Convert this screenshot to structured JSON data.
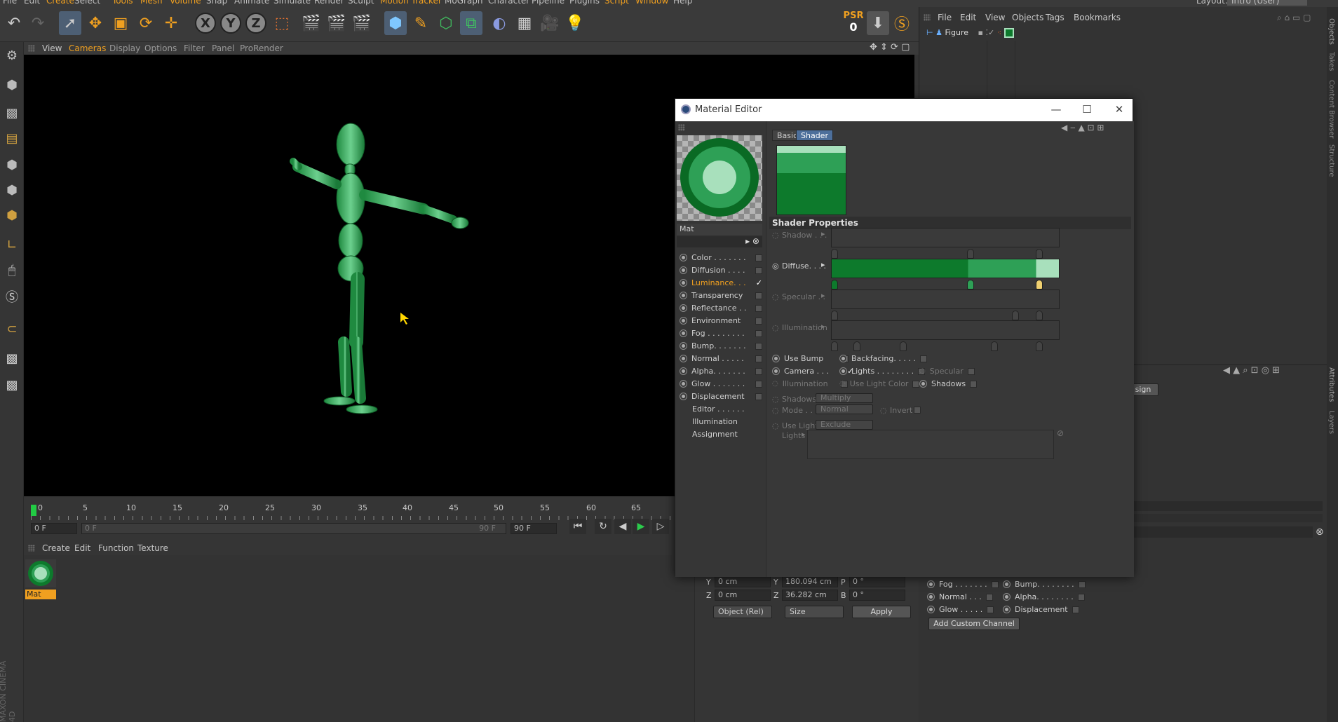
{
  "topmenu": [
    "File",
    "Edit",
    "Create",
    "Select",
    "Tools",
    "Mesh",
    "Volume",
    "Snap",
    "Animate",
    "Simulate",
    "Render",
    "Sculpt",
    "Motion Tracker",
    "MoGraph",
    "Character",
    "Pipeline",
    "Plugins",
    "Script",
    "Window",
    "Help"
  ],
  "layout_label": "Layout:",
  "layout_value": "Intro (User)",
  "toolbar": {
    "axis_x": "X",
    "axis_y": "Y",
    "axis_z": "Z",
    "psr_label": "PSR",
    "psr_value": "0"
  },
  "viewport_menu": [
    "View",
    "Cameras",
    "Display",
    "Options",
    "Filter",
    "Panel",
    "ProRender"
  ],
  "timeline": {
    "ticks": [
      "0",
      "5",
      "10",
      "15",
      "20",
      "25",
      "30",
      "35",
      "40",
      "45",
      "50",
      "55",
      "60",
      "65"
    ],
    "start_field": "0 F",
    "range_start": "0 F",
    "range_end": "90 F",
    "end_field": "90 F"
  },
  "material_menu": [
    "Create",
    "Edit",
    "Function",
    "Texture"
  ],
  "material": {
    "name": "Mat"
  },
  "coord": {
    "y_pos": "0 cm",
    "y_size": "180.094 cm",
    "p_rot": "0 °",
    "z_pos": "0 cm",
    "z_size": "36.282 cm",
    "b_rot": "0 °",
    "label_y": "Y",
    "label_z": "Z",
    "label_p": "P",
    "label_b": "B",
    "mode": "Object (Rel)",
    "size_mode": "Size",
    "apply": "Apply"
  },
  "objmgr": {
    "menu": [
      "File",
      "Edit",
      "View",
      "Objects",
      "Tags",
      "Bookmarks"
    ],
    "object_name": "Figure"
  },
  "attr": {
    "assign_button": "sign",
    "channels_left": [
      "Fog . . . . . . .",
      "Normal . . .",
      "Glow . . . . ."
    ],
    "channels_right": [
      "Bump. . . . . . . .",
      "Alpha. . . . . . . .",
      "Displacement"
    ],
    "add_custom_channel": "Add Custom Channel"
  },
  "right_strip": [
    "Objects",
    "Takes",
    "Content Browser",
    "Structure",
    "Attributes",
    "Layers"
  ],
  "material_editor": {
    "title": "Material Editor",
    "mat_name": "Mat",
    "channels": [
      {
        "label": "Color . . . . . . .",
        "checked": false
      },
      {
        "label": "Diffusion . . . .",
        "checked": false
      },
      {
        "label": "Luminance. . .",
        "checked": true
      },
      {
        "label": "Transparency",
        "checked": false
      },
      {
        "label": "Reflectance . .",
        "checked": false
      },
      {
        "label": "Environment",
        "checked": false
      },
      {
        "label": "Fog . . . . . . . .",
        "checked": false
      },
      {
        "label": "Bump. . . . . . .",
        "checked": false
      },
      {
        "label": "Normal . . . . .",
        "checked": false
      },
      {
        "label": "Alpha. . . . . . .",
        "checked": false
      },
      {
        "label": "Glow . . . . . . .",
        "checked": false
      },
      {
        "label": "Displacement",
        "checked": false
      }
    ],
    "extra": [
      "Editor . . . . . .",
      "Illumination",
      "Assignment"
    ],
    "tabs": [
      "Basic",
      "Shader"
    ],
    "section": "Shader Properties",
    "props": {
      "shadow": "Shadow . . .",
      "diffuse": "Diffuse. . . .",
      "specular": "Specular . .",
      "illumination": "Illumination",
      "use_bump": "Use Bump",
      "backfacing": "Backfacing. . . . .",
      "camera": "Camera . . .",
      "lights": "Lights . . . . . . . .",
      "specular2": "Specular",
      "illumination2": "Illumination",
      "use_light_color": "Use Light Color",
      "shadows": "Shadows",
      "shadows_label": "Shadows",
      "shadows_value": "Multiply",
      "mode_label": "Mode . . .",
      "mode_value": "Normal",
      "invert": "Invert",
      "use_lights": "Use Lights",
      "use_lights_value": "Exclude",
      "lights_list": "Lights"
    },
    "colors": {
      "dark_green": "#0d7a2c",
      "mid_green": "#2ea056",
      "light_green": "#a8e0bc"
    }
  }
}
